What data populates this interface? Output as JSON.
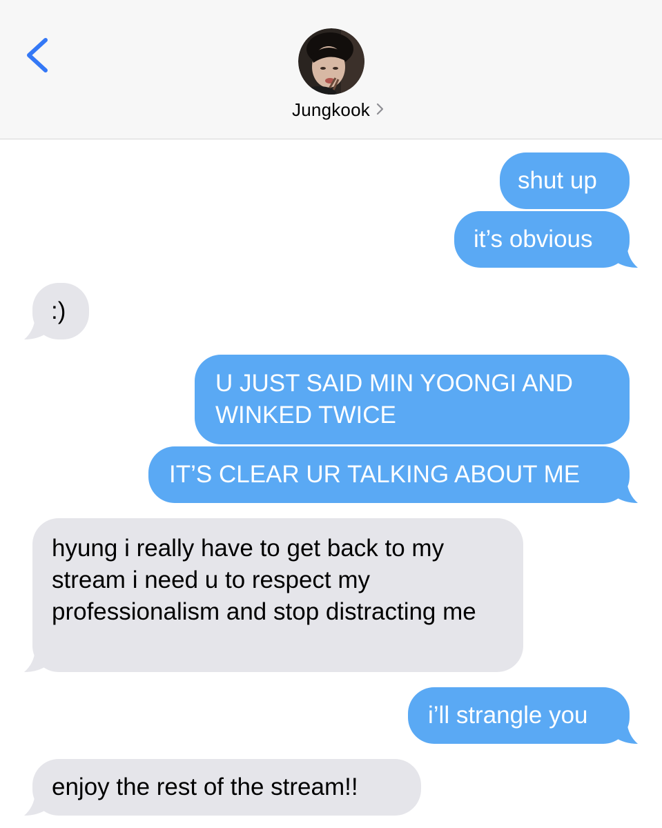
{
  "header": {
    "contact_name": "Jungkook",
    "back_icon": "chevron-left-icon",
    "detail_icon": "chevron-right-icon"
  },
  "colors": {
    "accent": "#3478f6",
    "sent_bubble": "#5aa9f4",
    "received_bubble": "#e5e5ea",
    "header_bg": "#f7f7f7"
  },
  "messages": [
    {
      "direction": "sent",
      "text": "shut up"
    },
    {
      "direction": "sent",
      "text": "it’s obvious"
    },
    {
      "direction": "received",
      "text": ":)"
    },
    {
      "direction": "sent",
      "text": "U JUST SAID MIN YOONGI AND WINKED TWICE"
    },
    {
      "direction": "sent",
      "text": "IT’S CLEAR UR TALKING ABOUT ME"
    },
    {
      "direction": "received",
      "text": "hyung i really have to get back to my stream i need u to respect my professionalism and stop distracting me"
    },
    {
      "direction": "sent",
      "text": "i’ll strangle you"
    },
    {
      "direction": "received",
      "text": "enjoy the rest of the stream!!"
    }
  ]
}
